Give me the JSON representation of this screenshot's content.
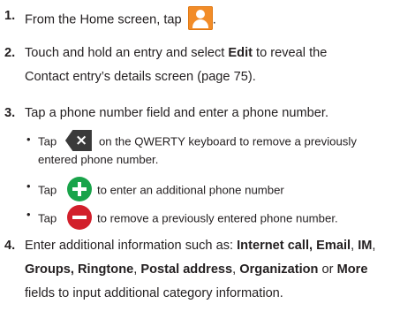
{
  "steps": [
    {
      "number": "1.",
      "text_before_icon": "From the Home screen, tap",
      "icon": "contacts-app-icon",
      "text_after_icon": "."
    },
    {
      "number": "2.",
      "line1_prefix": "Touch and hold an entry and select ",
      "line1_bold": "Edit",
      "line1_suffix": " to reveal the",
      "line2": "Contact entry’s details screen (page 75)."
    },
    {
      "number": "3.",
      "line1": "Tap a phone number field and enter a phone number.",
      "bullets": [
        {
          "prefix": "Tap",
          "icon": "backspace-delete-icon",
          "text": "on the QWERTY keyboard to remove a previously",
          "continuation": "entered phone number."
        },
        {
          "prefix": "Tap",
          "icon": "add-plus-icon",
          "text": "to enter an additional phone number"
        },
        {
          "prefix": "Tap",
          "icon": "remove-minus-icon",
          "text": "to remove a previously entered phone number."
        }
      ]
    },
    {
      "number": "4.",
      "line1_prefix": "Enter additional information such as: ",
      "line1_b1": "Internet call, Email",
      "line1_c1": ", ",
      "line1_b2": "IM",
      "line1_c2": ",",
      "line2_b1": "Groups, Ringtone",
      "line2_c1": ", ",
      "line2_b2": "Postal address",
      "line2_c2": ", ",
      "line2_b3": "Organization",
      "line2_c3": " or ",
      "line2_b4": "More",
      "line3": "fields to input additional category information."
    }
  ],
  "bullet_glyph": "•",
  "colors": {
    "text": "#231f20",
    "contacts_icon": "#f28c28",
    "delete_key": "#3a3a3a",
    "add": "#19a34a",
    "remove": "#d21f2b"
  }
}
